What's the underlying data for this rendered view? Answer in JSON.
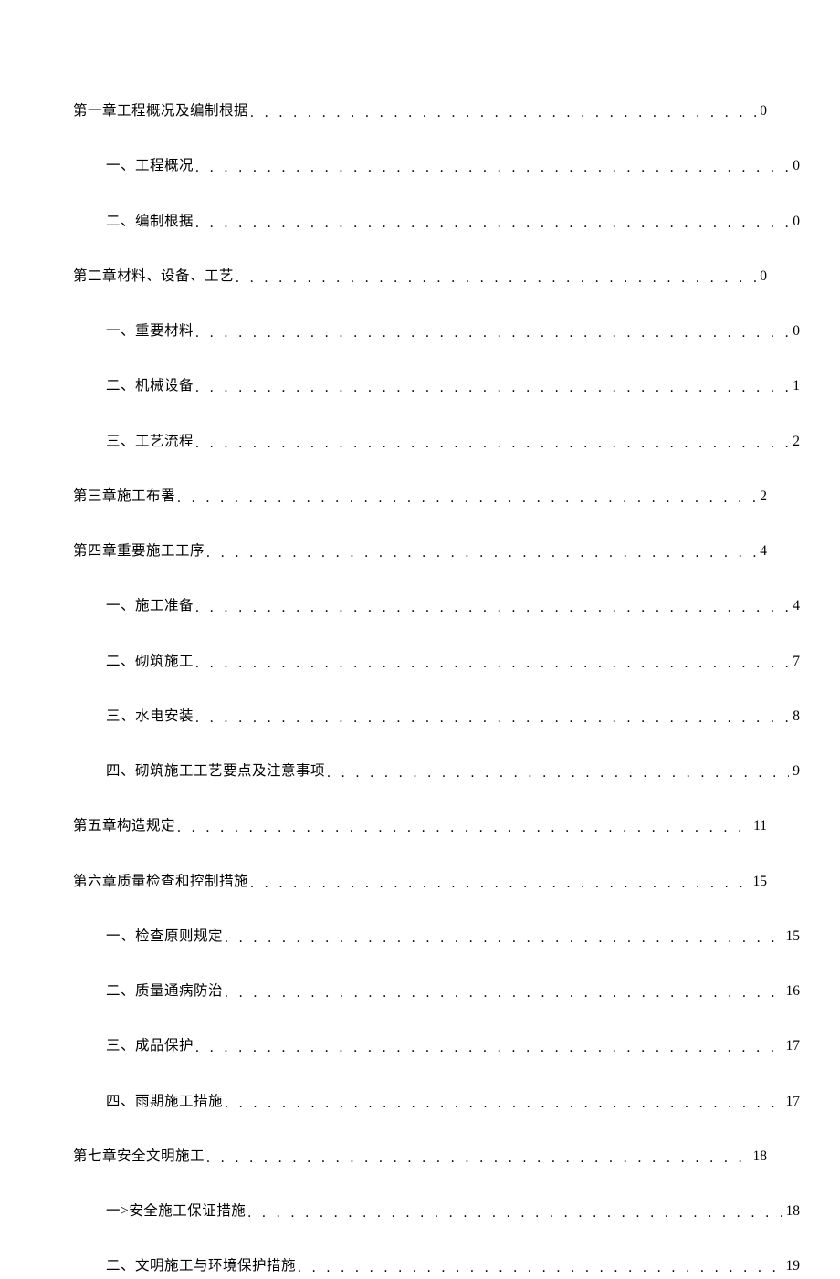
{
  "toc": [
    {
      "level": 1,
      "title": "第一章工程概况及编制根据",
      "page": "0"
    },
    {
      "level": 2,
      "title": "一、工程概况",
      "page": "0"
    },
    {
      "level": 2,
      "title": "二、编制根据",
      "page": "0"
    },
    {
      "level": 1,
      "title": "第二章材料、设备、工艺",
      "page": "0"
    },
    {
      "level": 2,
      "title": "一、重要材料",
      "page": "0"
    },
    {
      "level": 2,
      "title": "二、机械设备",
      "page": "1"
    },
    {
      "level": 2,
      "title": "三、工艺流程",
      "page": "2"
    },
    {
      "level": 1,
      "title": "第三章施工布署",
      "page": "2"
    },
    {
      "level": 1,
      "title": "第四章重要施工工序",
      "page": "4"
    },
    {
      "level": 2,
      "title": "一、施工准备",
      "page": "4"
    },
    {
      "level": 2,
      "title": "二、砌筑施工",
      "page": "7"
    },
    {
      "level": 2,
      "title": "三、水电安装",
      "page": "8"
    },
    {
      "level": 2,
      "title": "四、砌筑施工工艺要点及注意事项",
      "page": "9"
    },
    {
      "level": 1,
      "title": "第五章构造规定",
      "page": "11"
    },
    {
      "level": 1,
      "title": "第六章质量检查和控制措施",
      "page": "15"
    },
    {
      "level": 2,
      "title": "一、检查原则规定",
      "page": "15"
    },
    {
      "level": 2,
      "title": "二、质量通病防治",
      "page": "16"
    },
    {
      "level": 2,
      "title": "三、成品保护",
      "page": "17"
    },
    {
      "level": 2,
      "title": "四、雨期施工措施",
      "page": "17"
    },
    {
      "level": 1,
      "title": "第七章安全文明施工",
      "page": "18"
    },
    {
      "level": 2,
      "title": "一>安全施工保证措施",
      "page": "18"
    },
    {
      "level": 2,
      "title": "二、文明施工与环境保护措施",
      "page": "19"
    }
  ]
}
